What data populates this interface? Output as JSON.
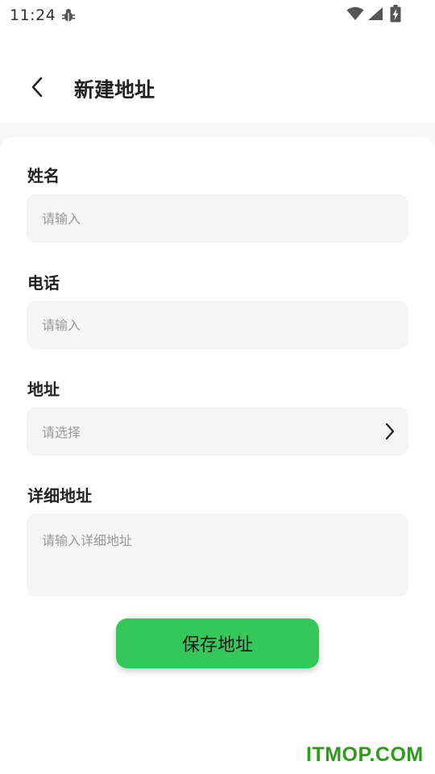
{
  "status_bar": {
    "time": "11:24"
  },
  "header": {
    "title": "新建地址"
  },
  "form": {
    "name": {
      "label": "姓名",
      "placeholder": "请输入"
    },
    "phone": {
      "label": "电话",
      "placeholder": "请输入"
    },
    "address": {
      "label": "地址",
      "placeholder": "请选择"
    },
    "detail": {
      "label": "详细地址",
      "placeholder": "请输入详细地址"
    }
  },
  "actions": {
    "save_label": "保存地址"
  },
  "watermark": "ITMOP.COM",
  "colors": {
    "accent": "#35c759",
    "field_bg": "#f5f5f5",
    "watermark": "#2f9a1c"
  }
}
